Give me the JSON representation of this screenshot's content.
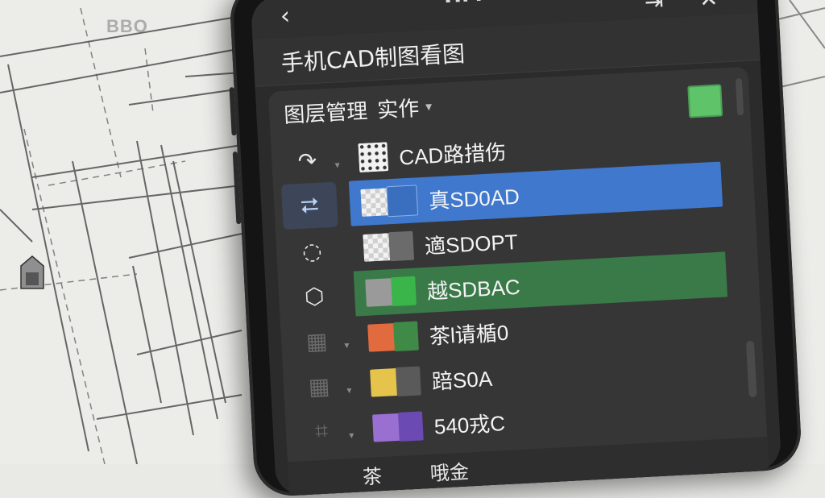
{
  "background": {
    "paper_label": "BBO"
  },
  "header": {
    "title": "HM",
    "back_icon": "chevron-left-icon",
    "export_icon": "export-icon",
    "close_icon": "close-icon"
  },
  "app": {
    "title": "手机CAD制图看图"
  },
  "layer_panel": {
    "title": "图层管理",
    "mode": "实作",
    "current_color": "#5fc36a"
  },
  "tools": [
    {
      "name": "rotate-icon",
      "glyph": "↷",
      "active": false,
      "dropdown": true
    },
    {
      "name": "swap-rotate-icon",
      "glyph": "⮂",
      "active": true,
      "dropdown": false
    },
    {
      "name": "circle-select-icon",
      "glyph": "◌",
      "active": false,
      "dropdown": false
    },
    {
      "name": "fill-shape-icon",
      "glyph": "⬡",
      "active": false,
      "dropdown": false
    },
    {
      "name": "layer-tool-icon",
      "glyph": "▦",
      "active": false,
      "dropdown": true
    },
    {
      "name": "snap-tool-icon",
      "glyph": "▦",
      "active": false,
      "dropdown": true
    },
    {
      "name": "crop-icon",
      "glyph": "⌗",
      "active": false,
      "dropdown": true
    }
  ],
  "layers": [
    {
      "name": "CAD路措伤",
      "swatch": "grid",
      "selected": false,
      "highlight": false
    },
    {
      "name": "真SD0AD",
      "swatch": "#f3f3f3",
      "swatch2": "",
      "selected": true,
      "highlight": false
    },
    {
      "name": "適SDOPT",
      "swatch": "#f3f3f3",
      "swatch2": "#6b6b6b",
      "selected": false,
      "highlight": false
    },
    {
      "name": "越SDBAC",
      "swatch": "#9a9a9a",
      "swatch2": "#39b54a",
      "selected": false,
      "highlight": true
    },
    {
      "name": "茶l请楯0",
      "swatch": "#e26a3f",
      "swatch2": "#3e8a46",
      "selected": false,
      "highlight": false
    },
    {
      "name": "踣S0A",
      "swatch": "#e6c34a",
      "swatch2": "#5a5a5a",
      "selected": false,
      "highlight": false
    },
    {
      "name": "540戎C",
      "swatch": "#9a6fd2",
      "swatch2": "#6b4ab3",
      "selected": false,
      "highlight": false
    }
  ],
  "bottom_bar": {
    "items": [
      "茶",
      "哦金"
    ]
  }
}
